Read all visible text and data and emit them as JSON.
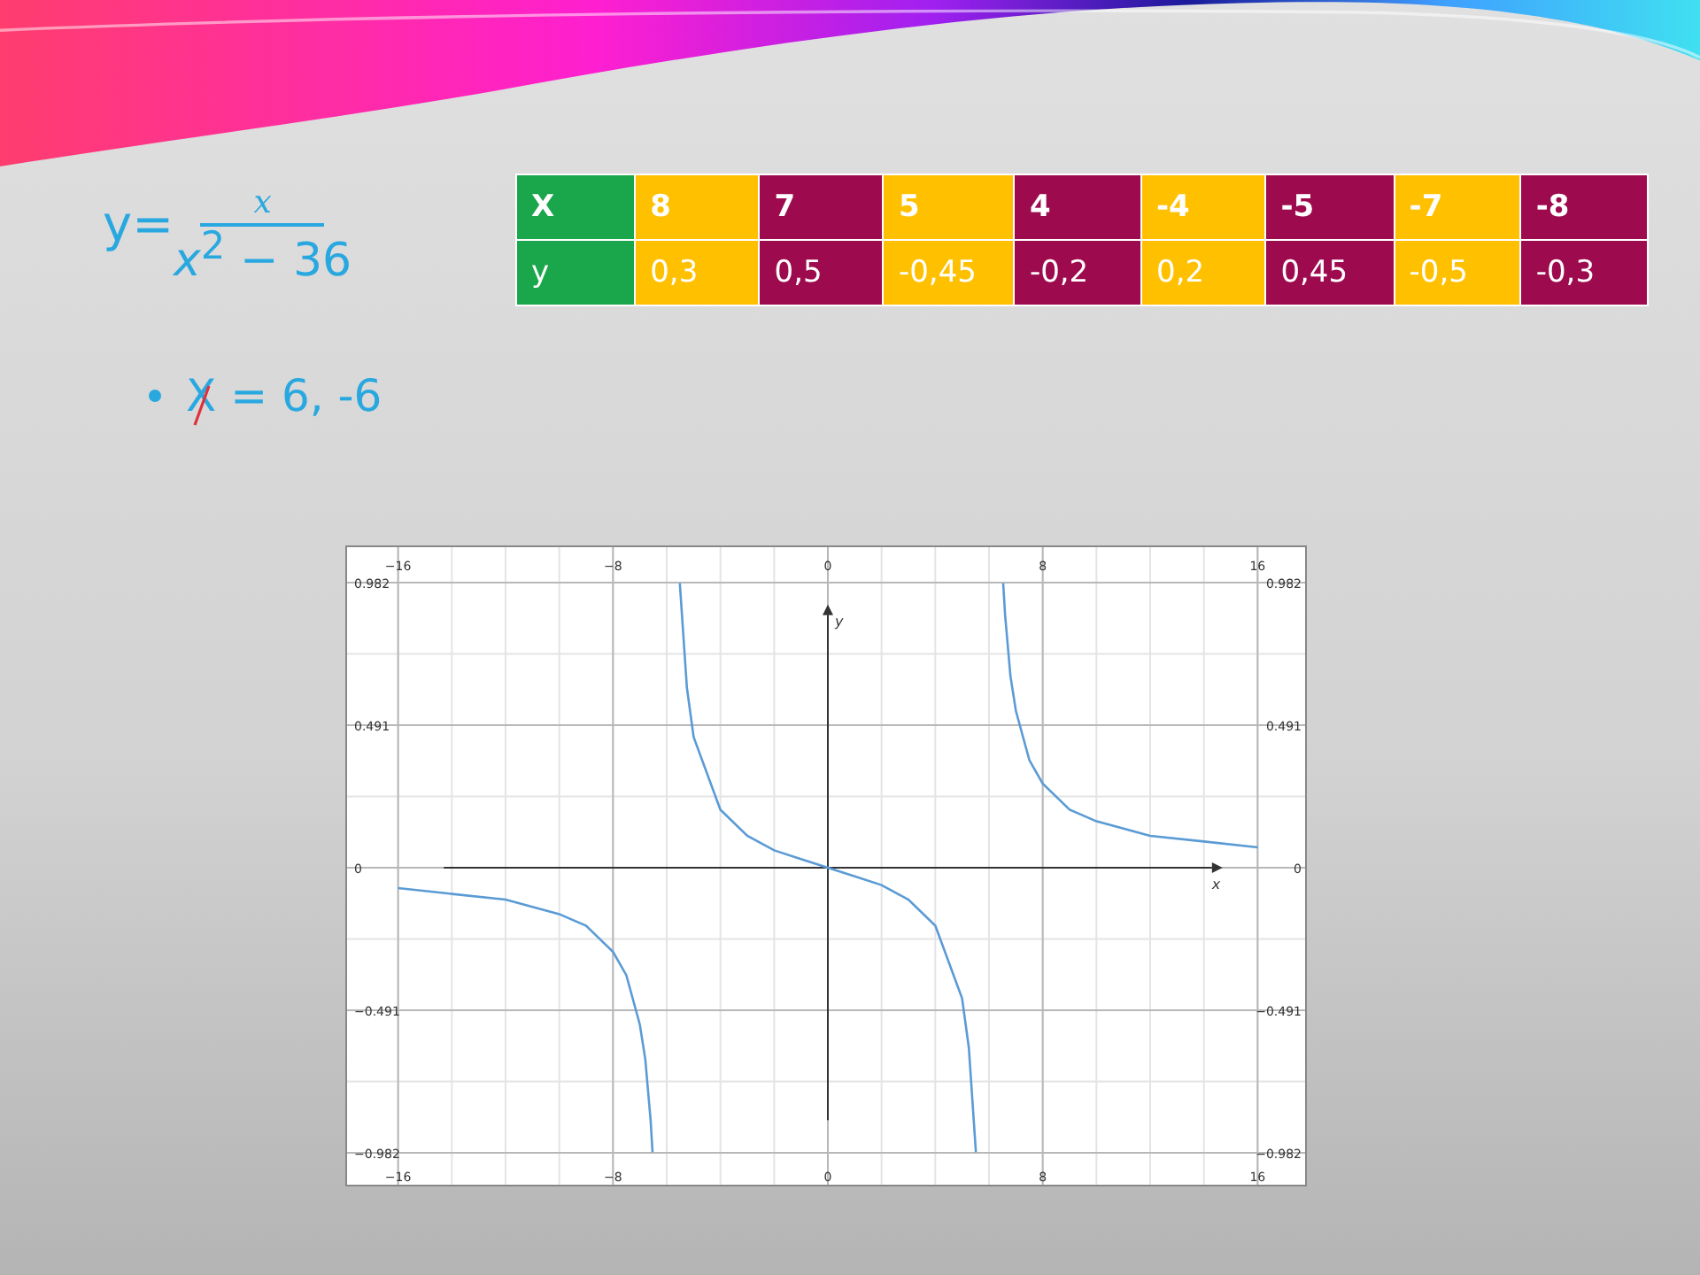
{
  "formula": {
    "lhs": "y=",
    "numerator": "*x*",
    "denominator": "*x*$^{2}$ − 36"
  },
  "table": {
    "rows": [
      {
        "cells": [
          {
            "text": "X",
            "color": "#1aa64a"
          },
          {
            "text": "8",
            "color": "#ffc000"
          },
          {
            "text": "7",
            "color": "#9e0a4e"
          },
          {
            "text": "5",
            "color": "#ffc000"
          },
          {
            "text": "4",
            "color": "#9e0a4e"
          },
          {
            "text": "-4",
            "color": "#ffc000"
          },
          {
            "text": "-5",
            "color": "#9e0a4e"
          },
          {
            "text": "-7",
            "color": "#ffc000"
          },
          {
            "text": "-8",
            "color": "#9e0a4e"
          }
        ],
        "bold": true
      },
      {
        "cells": [
          {
            "text": "y",
            "color": "#1aa64a"
          },
          {
            "text": "0,3",
            "color": "#ffc000"
          },
          {
            "text": "0,5",
            "color": "#9e0a4e"
          },
          {
            "text": "-0,45",
            "color": "#ffc000"
          },
          {
            "text": "-0,2",
            "color": "#9e0a4e"
          },
          {
            "text": "0,2",
            "color": "#ffc000"
          },
          {
            "text": "0,45",
            "color": "#9e0a4e"
          },
          {
            "text": "-0,5",
            "color": "#ffc000"
          },
          {
            "text": "-0,3",
            "color": "#9e0a4e"
          }
        ],
        "bold": false
      }
    ]
  },
  "bullet": {
    "text": "X = 6, -6",
    "struck": true
  },
  "graph": {
    "chart_data": {
      "type": "line",
      "xlabel": "x",
      "ylabel": "y",
      "grid": true,
      "x": [
        -16,
        -14,
        -12,
        -10,
        -9,
        -8,
        -7.5,
        -7,
        -6.8,
        -6.6,
        -6.53,
        -5.51,
        -5.25,
        -5,
        -4,
        -3,
        -2,
        -1,
        0,
        1,
        2,
        3,
        4,
        5,
        5.25,
        5.51,
        6.53,
        6.6,
        6.8,
        7,
        7.5,
        8,
        9,
        10,
        12,
        14,
        16
      ],
      "series": [
        {
          "color": "#5b9bd5",
          "values": [
            -0.07,
            -0.09,
            -0.11,
            -0.16,
            -0.2,
            -0.29,
            -0.37,
            -0.54,
            -0.66,
            -0.87,
            -0.98,
            null,
            null,
            null,
            null,
            null,
            null,
            null,
            null,
            null,
            null,
            null,
            null,
            null,
            null,
            null,
            null,
            null,
            null,
            null,
            null,
            null,
            null,
            null,
            null,
            null,
            null
          ]
        },
        {
          "color": "#5b9bd5",
          "values": [
            null,
            null,
            null,
            null,
            null,
            null,
            null,
            null,
            null,
            null,
            null,
            0.98,
            0.62,
            0.45,
            0.2,
            0.11,
            0.06,
            0.03,
            0,
            -0.03,
            -0.06,
            -0.11,
            -0.2,
            -0.45,
            -0.62,
            -0.98,
            null,
            null,
            null,
            null,
            null,
            null,
            null,
            null,
            null,
            null,
            null
          ]
        },
        {
          "color": "#5b9bd5",
          "values": [
            null,
            null,
            null,
            null,
            null,
            null,
            null,
            null,
            null,
            null,
            null,
            null,
            null,
            null,
            null,
            null,
            null,
            null,
            null,
            null,
            null,
            null,
            null,
            null,
            null,
            null,
            0.98,
            0.87,
            0.66,
            0.54,
            0.37,
            0.29,
            0.2,
            0.16,
            0.11,
            0.09,
            0.07
          ]
        }
      ],
      "xlim": [
        -17.9,
        17.9
      ],
      "ylim": [
        -1.104,
        1.104
      ],
      "xticks": [
        {
          "value": -16,
          "label": "−16"
        },
        {
          "value": -8,
          "label": "−8"
        },
        {
          "value": 0,
          "label": "0"
        },
        {
          "value": 8,
          "label": "8"
        },
        {
          "value": 16,
          "label": "16"
        }
      ],
      "yticks": [
        {
          "value": 0.982,
          "label": "0.982"
        },
        {
          "value": 0.491,
          "label": "0.491"
        },
        {
          "value": 0,
          "label": "0"
        },
        {
          "value": -0.491,
          "label": "−0.491"
        },
        {
          "value": -0.982,
          "label": "−0.982"
        }
      ]
    }
  }
}
